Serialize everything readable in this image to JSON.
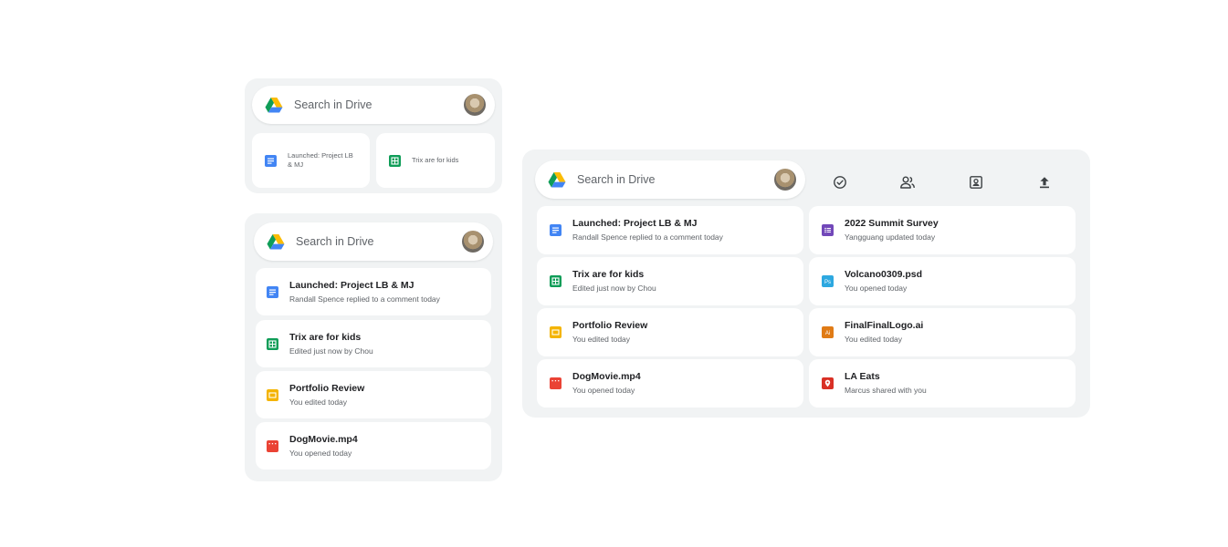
{
  "search_placeholder": "Search in Drive",
  "small_widget": {
    "items": [
      {
        "title": "Launched: Project LB & MJ",
        "icon": "docs-icon",
        "color": "#4285f4"
      },
      {
        "title": "Trix are for kids",
        "icon": "sheets-icon",
        "color": "#0f9d58"
      }
    ]
  },
  "medium_widget": {
    "items": [
      {
        "title": "Launched: Project LB & MJ",
        "subtitle": "Randall Spence replied to a comment today",
        "icon": "docs-icon",
        "color": "#4285f4"
      },
      {
        "title": "Trix are for kids",
        "subtitle": "Edited just now by Chou",
        "icon": "sheets-icon",
        "color": "#0f9d58"
      },
      {
        "title": "Portfolio Review",
        "subtitle": "You edited today",
        "icon": "slides-icon",
        "color": "#f4b400"
      },
      {
        "title": "DogMovie.mp4",
        "subtitle": "You opened today",
        "icon": "video-icon",
        "color": "#ea4335"
      }
    ]
  },
  "large_widget": {
    "toolbar": [
      {
        "name": "new-task-icon"
      },
      {
        "name": "shared-with-me-icon"
      },
      {
        "name": "scan-icon"
      },
      {
        "name": "upload-icon"
      }
    ],
    "left_items": [
      {
        "title": "Launched: Project LB & MJ",
        "subtitle": "Randall Spence replied to a comment today",
        "icon": "docs-icon",
        "color": "#4285f4"
      },
      {
        "title": "Trix are for kids",
        "subtitle": "Edited just now by Chou",
        "icon": "sheets-icon",
        "color": "#0f9d58"
      },
      {
        "title": "Portfolio Review",
        "subtitle": "You edited today",
        "icon": "slides-icon",
        "color": "#f4b400"
      },
      {
        "title": "DogMovie.mp4",
        "subtitle": "You opened today",
        "icon": "video-icon",
        "color": "#ea4335"
      }
    ],
    "right_items": [
      {
        "title": "2022 Summit Survey",
        "subtitle": "Yangguang updated today",
        "icon": "forms-icon",
        "color": "#7248b9",
        "glyph": "≡"
      },
      {
        "title": "Volcano0309.psd",
        "subtitle": "You opened today",
        "icon": "photoshop-icon",
        "color": "#2da8e0",
        "glyph": "Ps"
      },
      {
        "title": "FinalFinalLogo.ai",
        "subtitle": "You edited today",
        "icon": "illustrator-icon",
        "color": "#e07b16",
        "glyph": "Ai"
      },
      {
        "title": "LA Eats",
        "subtitle": "Marcus shared with you",
        "icon": "my-maps-icon",
        "color": "#d93025",
        "glyph": "●"
      }
    ]
  }
}
